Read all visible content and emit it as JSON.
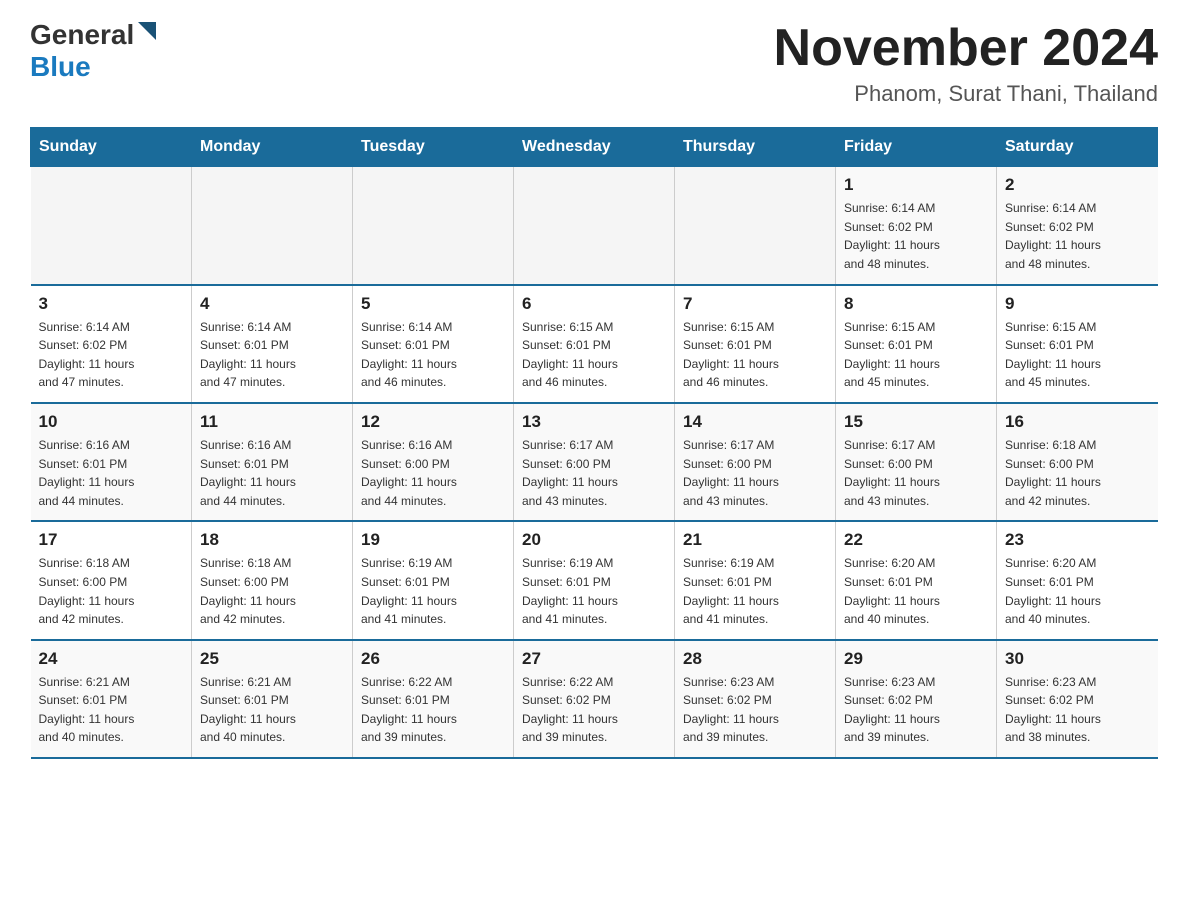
{
  "logo": {
    "general": "General",
    "blue": "Blue",
    "arrow_color": "#1a5276"
  },
  "title": "November 2024",
  "location": "Phanom, Surat Thani, Thailand",
  "days_of_week": [
    "Sunday",
    "Monday",
    "Tuesday",
    "Wednesday",
    "Thursday",
    "Friday",
    "Saturday"
  ],
  "weeks": [
    [
      {
        "day": "",
        "info": ""
      },
      {
        "day": "",
        "info": ""
      },
      {
        "day": "",
        "info": ""
      },
      {
        "day": "",
        "info": ""
      },
      {
        "day": "",
        "info": ""
      },
      {
        "day": "1",
        "info": "Sunrise: 6:14 AM\nSunset: 6:02 PM\nDaylight: 11 hours\nand 48 minutes."
      },
      {
        "day": "2",
        "info": "Sunrise: 6:14 AM\nSunset: 6:02 PM\nDaylight: 11 hours\nand 48 minutes."
      }
    ],
    [
      {
        "day": "3",
        "info": "Sunrise: 6:14 AM\nSunset: 6:02 PM\nDaylight: 11 hours\nand 47 minutes."
      },
      {
        "day": "4",
        "info": "Sunrise: 6:14 AM\nSunset: 6:01 PM\nDaylight: 11 hours\nand 47 minutes."
      },
      {
        "day": "5",
        "info": "Sunrise: 6:14 AM\nSunset: 6:01 PM\nDaylight: 11 hours\nand 46 minutes."
      },
      {
        "day": "6",
        "info": "Sunrise: 6:15 AM\nSunset: 6:01 PM\nDaylight: 11 hours\nand 46 minutes."
      },
      {
        "day": "7",
        "info": "Sunrise: 6:15 AM\nSunset: 6:01 PM\nDaylight: 11 hours\nand 46 minutes."
      },
      {
        "day": "8",
        "info": "Sunrise: 6:15 AM\nSunset: 6:01 PM\nDaylight: 11 hours\nand 45 minutes."
      },
      {
        "day": "9",
        "info": "Sunrise: 6:15 AM\nSunset: 6:01 PM\nDaylight: 11 hours\nand 45 minutes."
      }
    ],
    [
      {
        "day": "10",
        "info": "Sunrise: 6:16 AM\nSunset: 6:01 PM\nDaylight: 11 hours\nand 44 minutes."
      },
      {
        "day": "11",
        "info": "Sunrise: 6:16 AM\nSunset: 6:01 PM\nDaylight: 11 hours\nand 44 minutes."
      },
      {
        "day": "12",
        "info": "Sunrise: 6:16 AM\nSunset: 6:00 PM\nDaylight: 11 hours\nand 44 minutes."
      },
      {
        "day": "13",
        "info": "Sunrise: 6:17 AM\nSunset: 6:00 PM\nDaylight: 11 hours\nand 43 minutes."
      },
      {
        "day": "14",
        "info": "Sunrise: 6:17 AM\nSunset: 6:00 PM\nDaylight: 11 hours\nand 43 minutes."
      },
      {
        "day": "15",
        "info": "Sunrise: 6:17 AM\nSunset: 6:00 PM\nDaylight: 11 hours\nand 43 minutes."
      },
      {
        "day": "16",
        "info": "Sunrise: 6:18 AM\nSunset: 6:00 PM\nDaylight: 11 hours\nand 42 minutes."
      }
    ],
    [
      {
        "day": "17",
        "info": "Sunrise: 6:18 AM\nSunset: 6:00 PM\nDaylight: 11 hours\nand 42 minutes."
      },
      {
        "day": "18",
        "info": "Sunrise: 6:18 AM\nSunset: 6:00 PM\nDaylight: 11 hours\nand 42 minutes."
      },
      {
        "day": "19",
        "info": "Sunrise: 6:19 AM\nSunset: 6:01 PM\nDaylight: 11 hours\nand 41 minutes."
      },
      {
        "day": "20",
        "info": "Sunrise: 6:19 AM\nSunset: 6:01 PM\nDaylight: 11 hours\nand 41 minutes."
      },
      {
        "day": "21",
        "info": "Sunrise: 6:19 AM\nSunset: 6:01 PM\nDaylight: 11 hours\nand 41 minutes."
      },
      {
        "day": "22",
        "info": "Sunrise: 6:20 AM\nSunset: 6:01 PM\nDaylight: 11 hours\nand 40 minutes."
      },
      {
        "day": "23",
        "info": "Sunrise: 6:20 AM\nSunset: 6:01 PM\nDaylight: 11 hours\nand 40 minutes."
      }
    ],
    [
      {
        "day": "24",
        "info": "Sunrise: 6:21 AM\nSunset: 6:01 PM\nDaylight: 11 hours\nand 40 minutes."
      },
      {
        "day": "25",
        "info": "Sunrise: 6:21 AM\nSunset: 6:01 PM\nDaylight: 11 hours\nand 40 minutes."
      },
      {
        "day": "26",
        "info": "Sunrise: 6:22 AM\nSunset: 6:01 PM\nDaylight: 11 hours\nand 39 minutes."
      },
      {
        "day": "27",
        "info": "Sunrise: 6:22 AM\nSunset: 6:02 PM\nDaylight: 11 hours\nand 39 minutes."
      },
      {
        "day": "28",
        "info": "Sunrise: 6:23 AM\nSunset: 6:02 PM\nDaylight: 11 hours\nand 39 minutes."
      },
      {
        "day": "29",
        "info": "Sunrise: 6:23 AM\nSunset: 6:02 PM\nDaylight: 11 hours\nand 39 minutes."
      },
      {
        "day": "30",
        "info": "Sunrise: 6:23 AM\nSunset: 6:02 PM\nDaylight: 11 hours\nand 38 minutes."
      }
    ]
  ]
}
